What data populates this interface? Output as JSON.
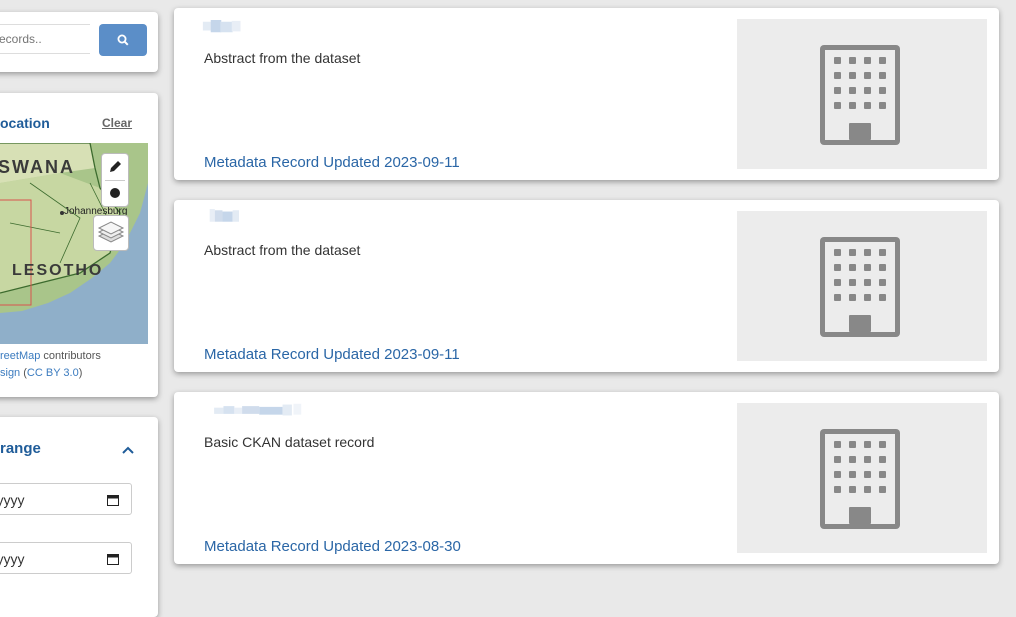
{
  "search": {
    "placeholder": "records.."
  },
  "location_filter": {
    "title": "ocation",
    "clear_label": "Clear",
    "map_labels": {
      "country_north": "SWANA",
      "city": "Johannesburg",
      "country_south": "LESOTHO"
    },
    "attribution_line1_link": "reetMap",
    "attribution_line1_text": " contributors",
    "attribution_line2_link1": "sign",
    "attribution_line2_open": " (",
    "attribution_line2_link2": "CC BY 3.0",
    "attribution_line2_close": ")"
  },
  "date_range": {
    "title": "range",
    "start_value": "m/yyyy",
    "end_value": "m/yyyy"
  },
  "records": [
    {
      "abstract": "Abstract from the dataset",
      "updated": "Metadata Record Updated 2023-09-11",
      "thumbnail_icon": "building-icon"
    },
    {
      "abstract": "Abstract from the dataset",
      "updated": "Metadata Record Updated 2023-09-11",
      "thumbnail_icon": "building-icon"
    },
    {
      "abstract": "Basic CKAN dataset record",
      "updated": "Metadata Record Updated 2023-08-30",
      "thumbnail_icon": "building-icon"
    }
  ],
  "colors": {
    "accent": "#1f5c99",
    "link": "#2a66a6",
    "search_button": "#5b8ec8",
    "thumbnail_bg": "#ececec",
    "icon_gray": "#888888"
  }
}
